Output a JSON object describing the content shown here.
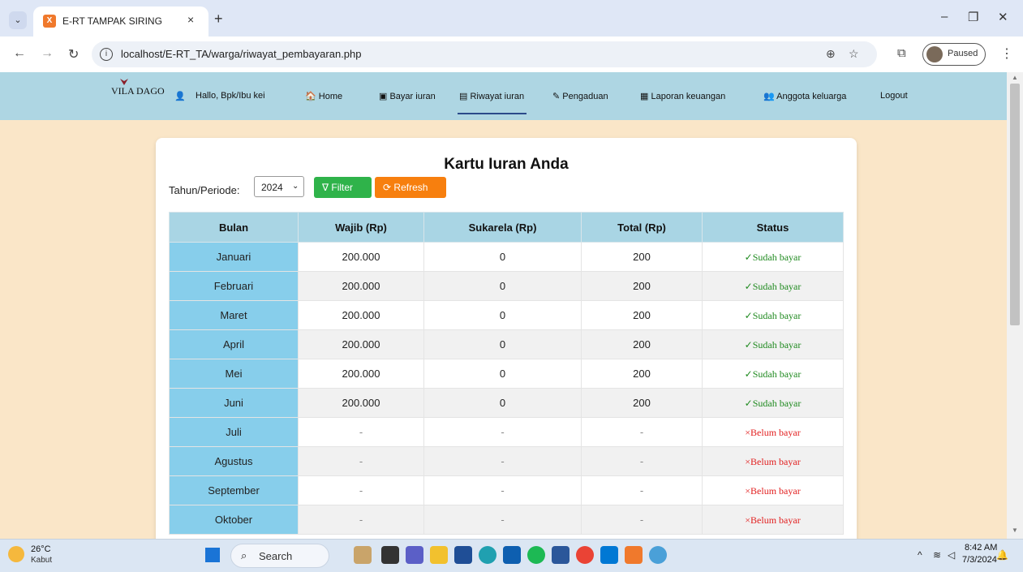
{
  "browser": {
    "tab_title": "E-RT TAMPAK SIRING",
    "tab_close": "×",
    "new_tab": "+",
    "url": "localhost/E-RT_TA/warga/riwayat_pembayaran.php",
    "profile_status": "Paused",
    "win_minimize": "–",
    "win_restore": "❐",
    "win_close": "✕"
  },
  "navbar": {
    "logo_text": "VILA DAGO",
    "greeting": "Hallo, Bpk/Ibu kei",
    "items": [
      {
        "label": "Home",
        "icon": "house-icon",
        "glyph": "🏠"
      },
      {
        "label": "Bayar iuran",
        "icon": "money-icon",
        "glyph": "▣"
      },
      {
        "label": "Riwayat iuran",
        "icon": "history-icon",
        "glyph": "▤"
      },
      {
        "label": "Pengaduan",
        "icon": "pen-icon",
        "glyph": "✎"
      },
      {
        "label": "Laporan keuangan",
        "icon": "report-icon",
        "glyph": "▦"
      },
      {
        "label": "Anggota keluarga",
        "icon": "users-icon",
        "glyph": "👥"
      },
      {
        "label": "Logout",
        "icon": "",
        "glyph": ""
      }
    ],
    "active_item": "Riwayat iuran"
  },
  "card": {
    "title": "Kartu Iuran Anda",
    "filter_label": "Tahun/Periode:",
    "year_selected": "2024",
    "filter_button": "Filter",
    "refresh_button": "Refresh"
  },
  "table": {
    "headers": [
      "Bulan",
      "Wajib (Rp)",
      "Sukarela (Rp)",
      "Total (Rp)",
      "Status"
    ],
    "rows": [
      {
        "bulan": "Januari",
        "wajib": "200.000",
        "sukarela": "0",
        "total": "200",
        "status": "✓Sudah bayar",
        "paid": true
      },
      {
        "bulan": "Februari",
        "wajib": "200.000",
        "sukarela": "0",
        "total": "200",
        "status": "✓Sudah bayar",
        "paid": true
      },
      {
        "bulan": "Maret",
        "wajib": "200.000",
        "sukarela": "0",
        "total": "200",
        "status": "✓Sudah bayar",
        "paid": true
      },
      {
        "bulan": "April",
        "wajib": "200.000",
        "sukarela": "0",
        "total": "200",
        "status": "✓Sudah bayar",
        "paid": true
      },
      {
        "bulan": "Mei",
        "wajib": "200.000",
        "sukarela": "0",
        "total": "200",
        "status": "✓Sudah bayar",
        "paid": true
      },
      {
        "bulan": "Juni",
        "wajib": "200.000",
        "sukarela": "0",
        "total": "200",
        "status": "✓Sudah bayar",
        "paid": true
      },
      {
        "bulan": "Juli",
        "wajib": "-",
        "sukarela": "-",
        "total": "-",
        "status": "×Belum bayar",
        "paid": false
      },
      {
        "bulan": "Agustus",
        "wajib": "-",
        "sukarela": "-",
        "total": "-",
        "status": "×Belum bayar",
        "paid": false
      },
      {
        "bulan": "September",
        "wajib": "-",
        "sukarela": "-",
        "total": "-",
        "status": "×Belum bayar",
        "paid": false
      },
      {
        "bulan": "Oktober",
        "wajib": "-",
        "sukarela": "-",
        "total": "-",
        "status": "×Belum bayar",
        "paid": false
      }
    ]
  },
  "taskbar": {
    "temperature": "26°C",
    "weather": "Kabut",
    "search_placeholder": "Search",
    "time": "8:42 AM",
    "date": "7/3/2024"
  },
  "colors": {
    "navbar": "#aed6e3",
    "page_background": "#fae6c8",
    "month_cell": "#87ceeb",
    "filter_button": "#2fb34a",
    "refresh_button": "#f77f0e",
    "paid_status": "#1f8a1f",
    "unpaid_status": "#e21f1f"
  }
}
